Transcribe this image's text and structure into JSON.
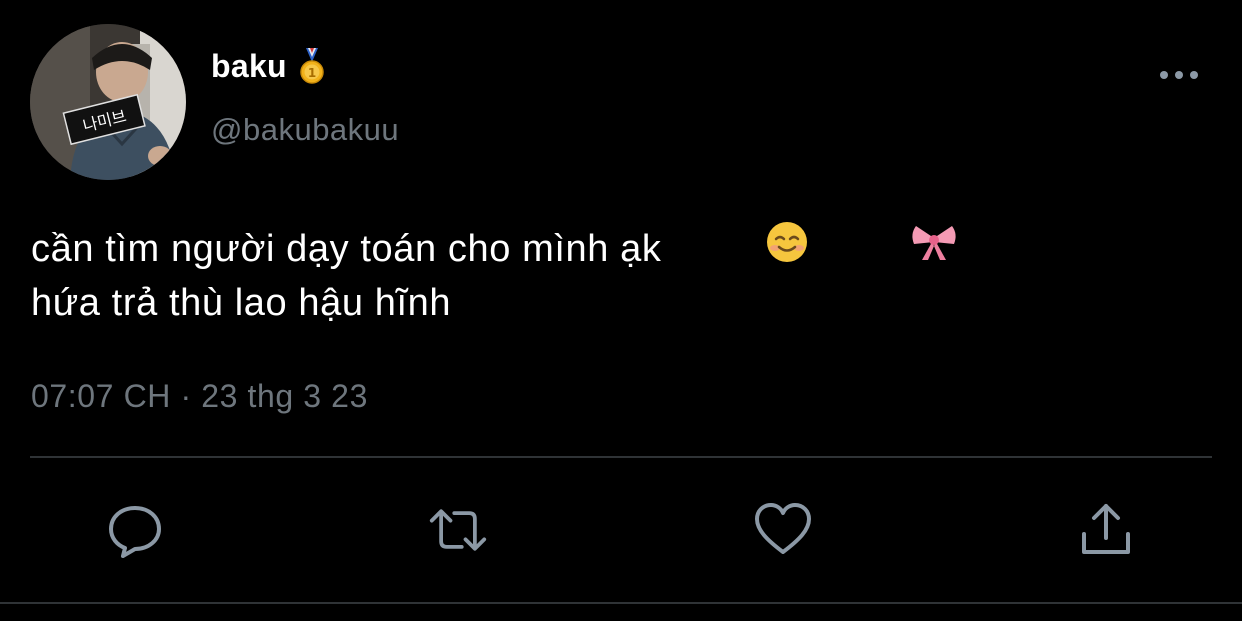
{
  "author": {
    "display_name": "baku",
    "handle": "@bakubakuu",
    "badge_icon": "medal-icon",
    "avatar_sign_text": "나미브"
  },
  "tweet": {
    "line1": "cần tìm người dạy toán cho mình ạk",
    "line1_emojis": [
      "☺️",
      "🎀"
    ],
    "line2": "hứa trả thù lao hậu hĩnh",
    "timestamp": "07:07 CH · 23 thg 3 23"
  },
  "actions": [
    {
      "name": "reply",
      "icon": "reply-icon"
    },
    {
      "name": "retweet",
      "icon": "retweet-icon"
    },
    {
      "name": "like",
      "icon": "heart-icon"
    },
    {
      "name": "share",
      "icon": "share-icon"
    }
  ],
  "colors": {
    "background": "#000000",
    "text": "#ffffff",
    "secondary": "#6e767d",
    "icon": "#8b98a5",
    "divider": "#2f3336"
  }
}
